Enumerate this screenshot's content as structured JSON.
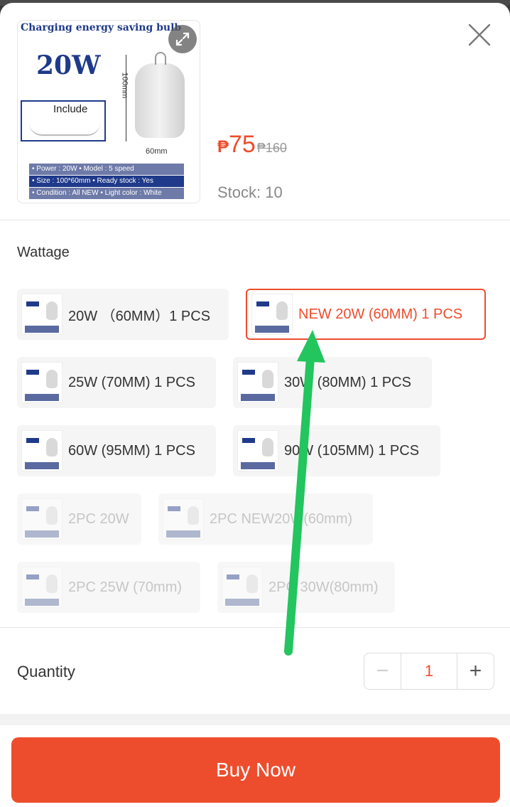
{
  "product": {
    "image_title": "Charging energy saving bulb",
    "image_watt": "20W",
    "image_include": "Include",
    "image_height": "100mm",
    "image_width": "60mm",
    "image_spec_a": "• Power : 20W        • Model : 5 speed",
    "image_spec_b": "• Size : 100*60mm   • Ready stock : Yes",
    "image_spec_c": "• Condition : All NEW • Light color : White",
    "expand_icon": "expand-icon",
    "currency": "₱",
    "price": "75",
    "original_price": "₱160",
    "stock_text": "Stock: 10"
  },
  "close_icon": "close-icon",
  "variation": {
    "label": "Wattage",
    "options": [
      {
        "label": "20W （60MM）1 PCS",
        "state": "normal"
      },
      {
        "label": "NEW 20W (60MM) 1 PCS",
        "state": "selected"
      },
      {
        "label": "25W (70MM) 1 PCS",
        "state": "normal"
      },
      {
        "label": "30W (80MM) 1 PCS",
        "state": "normal"
      },
      {
        "label": "60W (95MM) 1 PCS",
        "state": "normal"
      },
      {
        "label": "90W (105MM) 1 PCS",
        "state": "normal"
      },
      {
        "label": "2PC 20W",
        "state": "disabled"
      },
      {
        "label": "2PC NEW20W(60mm)",
        "state": "disabled"
      },
      {
        "label": "2PC 25W (70mm)",
        "state": "disabled"
      },
      {
        "label": "2PC 30W(80mm)",
        "state": "disabled"
      }
    ]
  },
  "quantity": {
    "label": "Quantity",
    "value": "1",
    "minus": "−",
    "plus": "+"
  },
  "buy_button": "Buy Now",
  "colors": {
    "accent": "#ee4d2d",
    "annotation_arrow": "#22c55e"
  }
}
